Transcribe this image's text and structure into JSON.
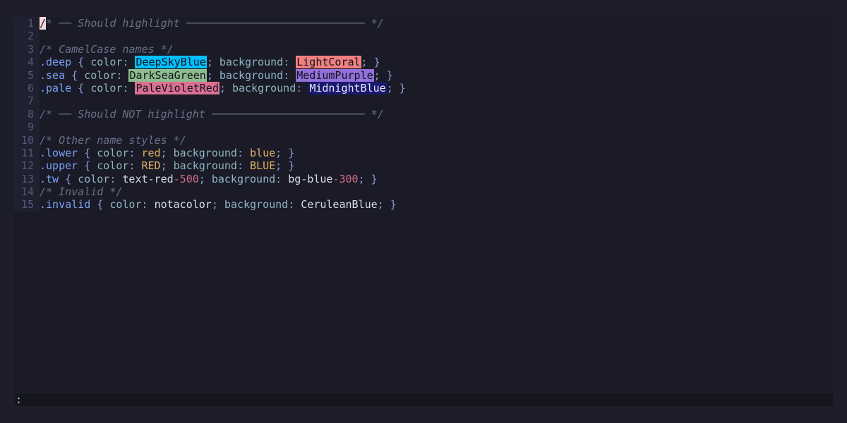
{
  "editor": {
    "lines": [
      {
        "n": "1",
        "tokens": [
          {
            "t": "/",
            "c": "cursor"
          },
          {
            "t": "* ── Should highlight ──────────────────────────── */",
            "c": "t-comment"
          }
        ]
      },
      {
        "n": "2",
        "tokens": []
      },
      {
        "n": "3",
        "tokens": [
          {
            "t": "/* CamelCase names */",
            "c": "t-comment"
          }
        ]
      },
      {
        "n": "4",
        "tokens": [
          {
            "t": ".deep",
            "c": "t-sel"
          },
          {
            "t": " { ",
            "c": "t-punct"
          },
          {
            "t": "color",
            "c": "t-prop"
          },
          {
            "t": ": ",
            "c": "t-punct"
          },
          {
            "t": "DeepSkyBlue",
            "c": "sw",
            "bg": "#00bfff",
            "fg": "#10121a"
          },
          {
            "t": "; ",
            "c": "t-punct"
          },
          {
            "t": "background",
            "c": "t-prop"
          },
          {
            "t": ": ",
            "c": "t-punct"
          },
          {
            "t": "LightCoral",
            "c": "sw",
            "bg": "#f08080",
            "fg": "#10121a"
          },
          {
            "t": "; }",
            "c": "t-punct"
          }
        ]
      },
      {
        "n": "5",
        "tokens": [
          {
            "t": ".sea",
            "c": "t-sel"
          },
          {
            "t": " { ",
            "c": "t-punct"
          },
          {
            "t": "color",
            "c": "t-prop"
          },
          {
            "t": ": ",
            "c": "t-punct"
          },
          {
            "t": "DarkSeaGreen",
            "c": "sw",
            "bg": "#8fbc8f",
            "fg": "#10121a"
          },
          {
            "t": "; ",
            "c": "t-punct"
          },
          {
            "t": "background",
            "c": "t-prop"
          },
          {
            "t": ": ",
            "c": "t-punct"
          },
          {
            "t": "MediumPurple",
            "c": "sw",
            "bg": "#9370db",
            "fg": "#10121a"
          },
          {
            "t": "; }",
            "c": "t-punct"
          }
        ]
      },
      {
        "n": "6",
        "tokens": [
          {
            "t": ".pale",
            "c": "t-sel"
          },
          {
            "t": " { ",
            "c": "t-punct"
          },
          {
            "t": "color",
            "c": "t-prop"
          },
          {
            "t": ": ",
            "c": "t-punct"
          },
          {
            "t": "PaleVioletRed",
            "c": "sw",
            "bg": "#db7093",
            "fg": "#10121a"
          },
          {
            "t": "; ",
            "c": "t-punct"
          },
          {
            "t": "background",
            "c": "t-prop"
          },
          {
            "t": ": ",
            "c": "t-punct"
          },
          {
            "t": "MidnightBlue",
            "c": "sw",
            "bg": "#191970",
            "fg": "#e6e8f5"
          },
          {
            "t": "; }",
            "c": "t-punct"
          }
        ]
      },
      {
        "n": "7",
        "tokens": []
      },
      {
        "n": "8",
        "tokens": [
          {
            "t": "/* ── Should NOT highlight ──────────────────────── */",
            "c": "t-comment"
          }
        ]
      },
      {
        "n": "9",
        "tokens": []
      },
      {
        "n": "10",
        "tokens": [
          {
            "t": "/* Other name styles */",
            "c": "t-comment"
          }
        ]
      },
      {
        "n": "11",
        "tokens": [
          {
            "t": ".lower",
            "c": "t-sel"
          },
          {
            "t": " { ",
            "c": "t-punct"
          },
          {
            "t": "color",
            "c": "t-prop"
          },
          {
            "t": ": ",
            "c": "t-punct"
          },
          {
            "t": "red",
            "c": "t-val"
          },
          {
            "t": "; ",
            "c": "t-punct"
          },
          {
            "t": "background",
            "c": "t-prop"
          },
          {
            "t": ": ",
            "c": "t-punct"
          },
          {
            "t": "blue",
            "c": "t-val"
          },
          {
            "t": "; }",
            "c": "t-punct"
          }
        ]
      },
      {
        "n": "12",
        "tokens": [
          {
            "t": ".upper",
            "c": "t-sel"
          },
          {
            "t": " { ",
            "c": "t-punct"
          },
          {
            "t": "color",
            "c": "t-prop"
          },
          {
            "t": ": ",
            "c": "t-punct"
          },
          {
            "t": "RED",
            "c": "t-val"
          },
          {
            "t": "; ",
            "c": "t-punct"
          },
          {
            "t": "background",
            "c": "t-prop"
          },
          {
            "t": ": ",
            "c": "t-punct"
          },
          {
            "t": "BLUE",
            "c": "t-val"
          },
          {
            "t": "; }",
            "c": "t-punct"
          }
        ]
      },
      {
        "n": "13",
        "tokens": [
          {
            "t": ".tw",
            "c": "t-sel"
          },
          {
            "t": " { ",
            "c": "t-punct"
          },
          {
            "t": "color",
            "c": "t-prop"
          },
          {
            "t": ": ",
            "c": "t-punct"
          },
          {
            "t": "text-red",
            "c": "t-plain"
          },
          {
            "t": "-500",
            "c": "t-num"
          },
          {
            "t": "; ",
            "c": "t-punct"
          },
          {
            "t": "background",
            "c": "t-prop"
          },
          {
            "t": ": ",
            "c": "t-punct"
          },
          {
            "t": "bg-blue",
            "c": "t-plain"
          },
          {
            "t": "-300",
            "c": "t-num"
          },
          {
            "t": "; }",
            "c": "t-punct"
          }
        ]
      },
      {
        "n": "14",
        "tokens": [
          {
            "t": "/* Invalid */",
            "c": "t-comment"
          }
        ]
      },
      {
        "n": "15",
        "tokens": [
          {
            "t": ".invalid",
            "c": "t-sel"
          },
          {
            "t": " { ",
            "c": "t-punct"
          },
          {
            "t": "color",
            "c": "t-prop"
          },
          {
            "t": ": ",
            "c": "t-punct"
          },
          {
            "t": "notacolor",
            "c": "t-plain"
          },
          {
            "t": "; ",
            "c": "t-punct"
          },
          {
            "t": "background",
            "c": "t-prop"
          },
          {
            "t": ": ",
            "c": "t-punct"
          },
          {
            "t": "CeruleanBlue",
            "c": "t-plain"
          },
          {
            "t": "; }",
            "c": "t-punct"
          }
        ]
      }
    ]
  },
  "statusbar": {
    "command_text": ":"
  }
}
